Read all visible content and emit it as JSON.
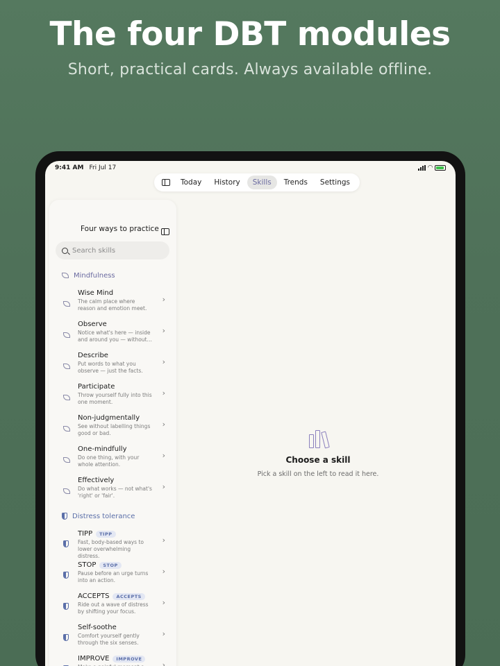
{
  "hero": {
    "title": "The four DBT modules",
    "subtitle": "Short, practical cards. Always available offline."
  },
  "status": {
    "time": "9:41 AM",
    "date": "Fri Jul 17"
  },
  "tabs": {
    "today": "Today",
    "history": "History",
    "skills": "Skills",
    "trends": "Trends",
    "settings": "Settings",
    "active": "skills"
  },
  "sidebar": {
    "title": "Four ways to practice",
    "search_placeholder": "Search skills",
    "sections": [
      {
        "label": "Mindfulness",
        "icon": "leaf-icon",
        "items": [
          {
            "name": "Wise Mind",
            "desc": "The calm place where reason and emotion meet."
          },
          {
            "name": "Observe",
            "desc": "Notice what's here — inside and around you — without…"
          },
          {
            "name": "Describe",
            "desc": "Put words to what you observe — just the facts."
          },
          {
            "name": "Participate",
            "desc": "Throw yourself fully into this one moment."
          },
          {
            "name": "Non-judgmentally",
            "desc": "See without labelling things good or bad."
          },
          {
            "name": "One-mindfully",
            "desc": "Do one thing, with your whole attention."
          },
          {
            "name": "Effectively",
            "desc": "Do what works — not what's 'right' or 'fair'."
          }
        ]
      },
      {
        "label": "Distress tolerance",
        "icon": "shield-icon",
        "items": [
          {
            "name": "TIPP",
            "badge": "TIPP",
            "desc": "Fast, body-based ways to lower overwhelming distress."
          },
          {
            "name": "STOP",
            "badge": "STOP",
            "desc": "Pause before an urge turns into an action."
          },
          {
            "name": "ACCEPTS",
            "badge": "ACCEPTS",
            "desc": "Ride out a wave of distress by shifting your focus."
          },
          {
            "name": "Self-soothe",
            "desc": "Comfort yourself gently through the six senses."
          },
          {
            "name": "IMPROVE",
            "badge": "IMPROVE",
            "desc": "Make a painful moment a"
          }
        ]
      }
    ]
  },
  "detail": {
    "empty_title": "Choose a skill",
    "empty_subtitle": "Pick a skill on the left to read it here."
  },
  "colors": {
    "background": "#4f7159",
    "accent": "#6a6aa0",
    "distress_accent": "#5a6ea8"
  }
}
